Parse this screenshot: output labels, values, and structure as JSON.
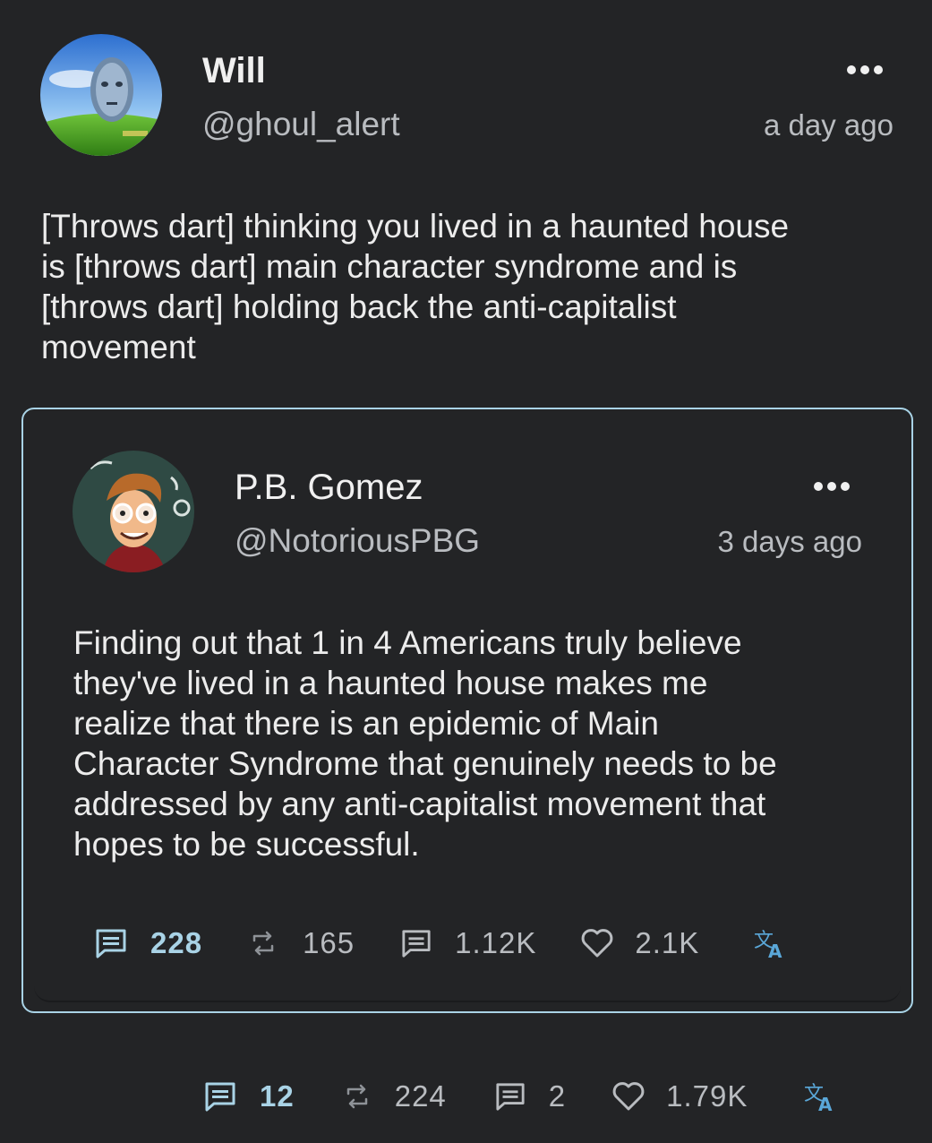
{
  "post": {
    "author_name": "Will",
    "author_handle": "@ghoul_alert",
    "timestamp": "a day ago",
    "text_lines": [
      "[Throws dart] thinking you lived in a haunted house",
      "is [throws dart] main character syndrome and is",
      "[throws dart] holding back the anti-capitalist",
      "movement"
    ],
    "stats": {
      "replies": "12",
      "reposts": "224",
      "quotes": "2",
      "likes": "1.79K"
    }
  },
  "quoted_post": {
    "author_name": "P.B. Gomez",
    "author_handle": "@NotoriousPBG",
    "timestamp": "3 days ago",
    "text_lines": [
      "Finding out that 1 in 4 Americans truly believe",
      "they've lived in a haunted house makes me",
      "realize that there is an epidemic of Main",
      "Character Syndrome that genuinely needs to be",
      "addressed by any anti-capitalist movement that",
      "hopes to be successful."
    ],
    "stats": {
      "replies": "228",
      "reposts": "165",
      "quotes": "1.12K",
      "likes": "2.1K"
    }
  },
  "icons": {
    "reply": "reply-icon",
    "repost": "repost-icon",
    "quote": "quote-icon",
    "like": "heart-icon",
    "translate": "translate-icon",
    "more": "more-icon"
  },
  "colors": {
    "background": "#232426",
    "accent": "#a9d3e6",
    "text": "#ececec",
    "muted": "#b9bcc0",
    "reply_active": "#a9d3e6"
  }
}
